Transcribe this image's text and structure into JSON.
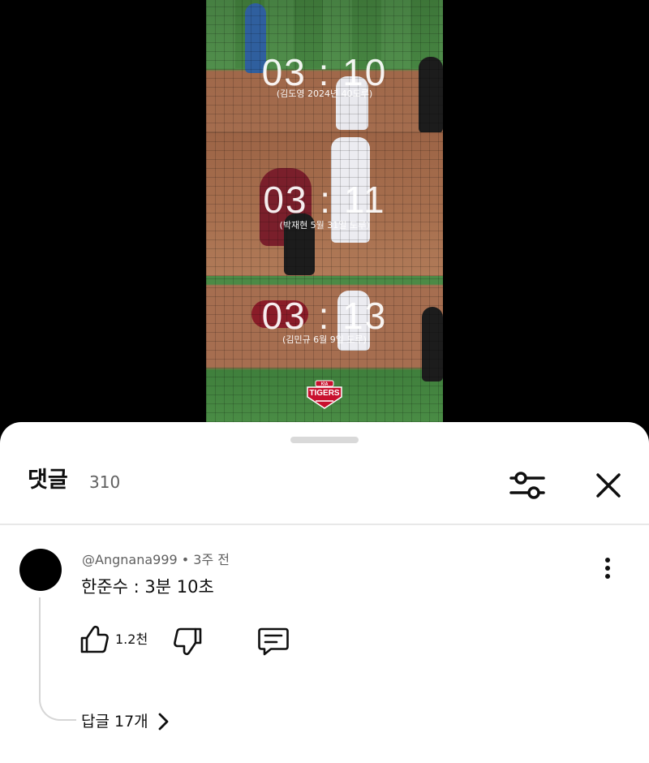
{
  "video": {
    "clips": [
      {
        "time": "03 : 10",
        "note": "(김도영 2024년 40도루)"
      },
      {
        "time": "03 : 11",
        "note": "(박재현 5월 31일 도루)"
      },
      {
        "time": "03 : 13",
        "note": "(김민규 6월 9일 도루)"
      }
    ],
    "logo": {
      "brand": "TIGERS",
      "tagline": "KIA",
      "color": "#c8102e"
    }
  },
  "comments_panel": {
    "title": "댓글",
    "count": "310",
    "sort_icon": "sliders-icon",
    "close_icon": "close-icon"
  },
  "comment": {
    "author": "@Angnana999",
    "separator": "•",
    "time": "3주 전",
    "text": "한준수 : 3분 10초",
    "likes": "1.2천",
    "replies_label": "답글 17개",
    "avatar_color": "#000000"
  }
}
